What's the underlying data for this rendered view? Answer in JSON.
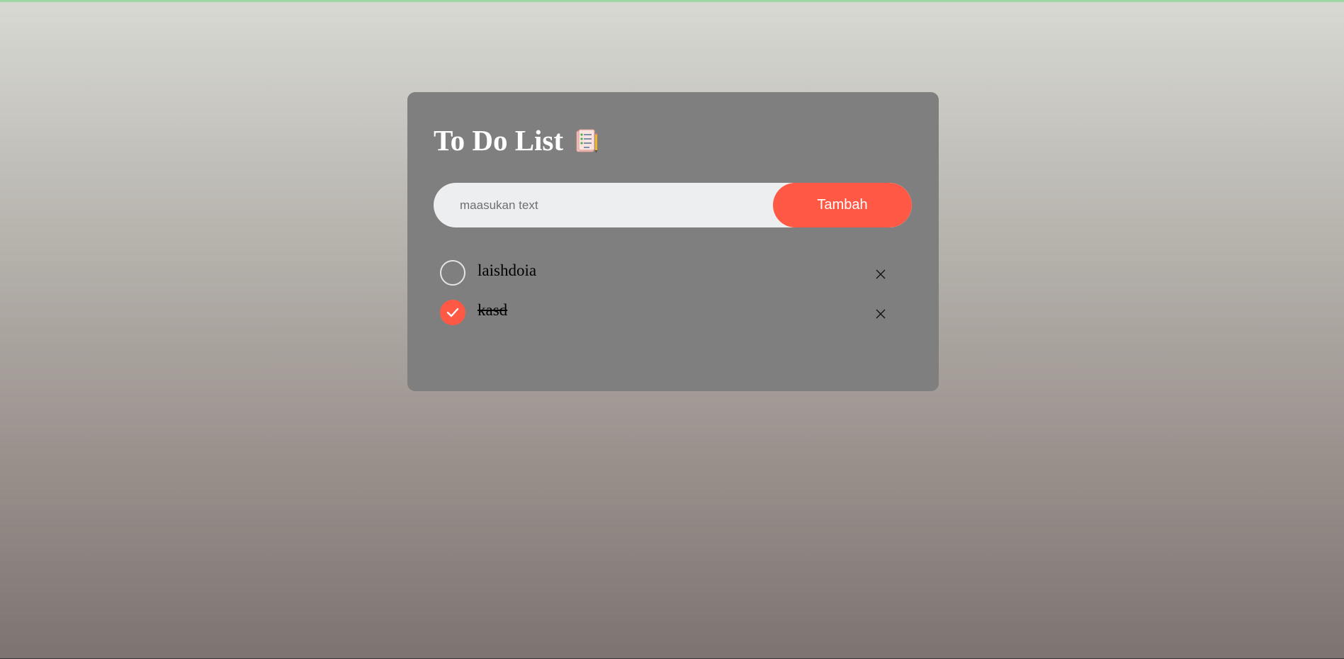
{
  "app": {
    "title": "To Do List",
    "title_icon": "notepad-checklist-icon"
  },
  "input": {
    "placeholder": "maasukan text",
    "value": ""
  },
  "add_button": {
    "label": "Tambah"
  },
  "tasks": [
    {
      "text": "laishdoia",
      "checked": false,
      "check_icon": "unchecked-circle-icon",
      "delete_icon": "close-icon"
    },
    {
      "text": "kasd",
      "checked": true,
      "check_icon": "checked-circle-icon",
      "delete_icon": "close-icon"
    }
  ],
  "colors": {
    "accent": "#ff5945",
    "card": "#7f7f7f",
    "input_bg": "#edeef0",
    "title_text": "#ffffff"
  }
}
